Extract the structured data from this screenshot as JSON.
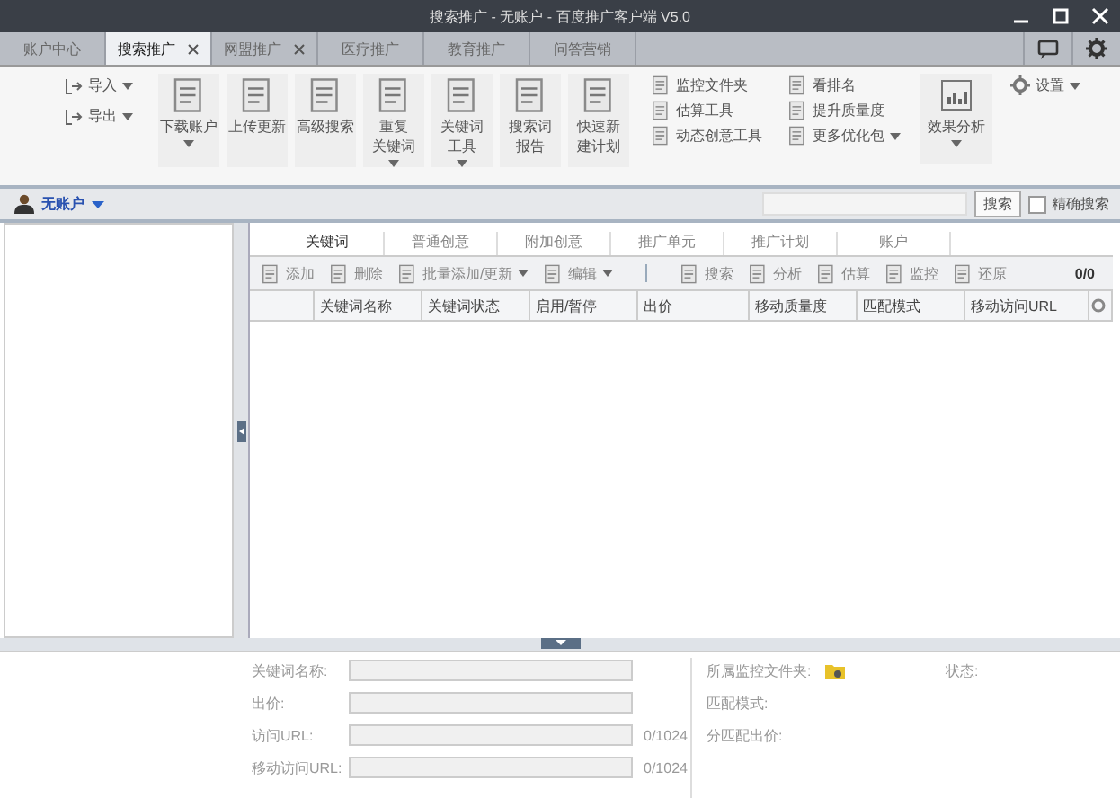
{
  "window": {
    "title": "搜索推广 - 无账户 - 百度推广客户端 V5.0"
  },
  "tabs": [
    {
      "label": "账户中心",
      "selected": false,
      "closable": false
    },
    {
      "label": "搜索推广",
      "selected": true,
      "closable": true
    },
    {
      "label": "网盟推广",
      "selected": false,
      "closable": true
    },
    {
      "label": "医疗推广",
      "selected": false,
      "closable": false
    },
    {
      "label": "教育推广",
      "selected": false,
      "closable": false
    },
    {
      "label": "问答营销",
      "selected": false,
      "closable": false
    }
  ],
  "toolbar": {
    "import_export": [
      {
        "label": "导入",
        "has_menu": true
      },
      {
        "label": "导出",
        "has_menu": true
      }
    ],
    "big_buttons": [
      {
        "lines": [
          "下载账户"
        ],
        "has_menu": true
      },
      {
        "lines": [
          "上传更新"
        ],
        "has_menu": false
      },
      {
        "lines": [
          "高级搜索"
        ],
        "has_menu": false
      },
      {
        "lines": [
          "重复",
          "关键词"
        ],
        "has_menu": true
      },
      {
        "lines": [
          "关键词",
          "工具"
        ],
        "has_menu": true
      },
      {
        "lines": [
          "搜索词",
          "报告"
        ],
        "has_menu": false
      },
      {
        "lines": [
          "快速新",
          "建计划"
        ],
        "has_menu": false
      }
    ],
    "small_columns": [
      [
        {
          "label": "监控文件夹",
          "has_menu": false
        },
        {
          "label": "估算工具",
          "has_menu": false
        },
        {
          "label": "动态创意工具",
          "has_menu": false
        }
      ],
      [
        {
          "label": "看排名",
          "has_menu": false
        },
        {
          "label": "提升质量度",
          "has_menu": false
        },
        {
          "label": "更多优化包",
          "has_menu": true
        }
      ]
    ],
    "analysis": {
      "label": "效果分析",
      "has_menu": true
    },
    "settings": {
      "label": "设置",
      "has_menu": true
    }
  },
  "account_bar": {
    "account": "无账户",
    "search_button": "搜索",
    "exact_search": {
      "label": "精确搜索",
      "checked": false
    }
  },
  "level_tabs": [
    {
      "label": "关键词",
      "selected": true
    },
    {
      "label": "普通创意",
      "selected": false
    },
    {
      "label": "附加创意",
      "selected": false
    },
    {
      "label": "推广单元",
      "selected": false
    },
    {
      "label": "推广计划",
      "selected": false
    },
    {
      "label": "账户",
      "selected": false
    }
  ],
  "actions": [
    {
      "label": "添加",
      "has_menu": false,
      "separator_after": false
    },
    {
      "label": "删除",
      "has_menu": false,
      "separator_after": false
    },
    {
      "label": "批量添加/更新",
      "has_menu": true,
      "separator_after": false
    },
    {
      "label": "编辑",
      "has_menu": true,
      "separator_after": true
    },
    {
      "label": "搜索",
      "has_menu": false,
      "separator_after": false
    },
    {
      "label": "分析",
      "has_menu": false,
      "separator_after": false
    },
    {
      "label": "估算",
      "has_menu": false,
      "separator_after": false
    },
    {
      "label": "监控",
      "has_menu": false,
      "separator_after": false
    },
    {
      "label": "还原",
      "has_menu": false,
      "separator_after": false
    }
  ],
  "pager": "0/0",
  "table": {
    "columns": [
      "关键词名称",
      "关键词状态",
      "启用/暂停",
      "出价",
      "移动质量度",
      "匹配模式",
      "移动访问URL"
    ]
  },
  "details": {
    "left": [
      {
        "label": "关键词名称:"
      },
      {
        "label": "出价:"
      },
      {
        "label": "访问URL:",
        "counter": "0/1024"
      },
      {
        "label": "移动访问URL:",
        "counter": "0/1024"
      }
    ],
    "right": [
      {
        "label": "所属监控文件夹:",
        "kind": "folder"
      },
      {
        "label": "匹配模式:",
        "kind": "text"
      },
      {
        "label": "分匹配出价:",
        "kind": "text"
      }
    ],
    "status_label": "状态:"
  }
}
